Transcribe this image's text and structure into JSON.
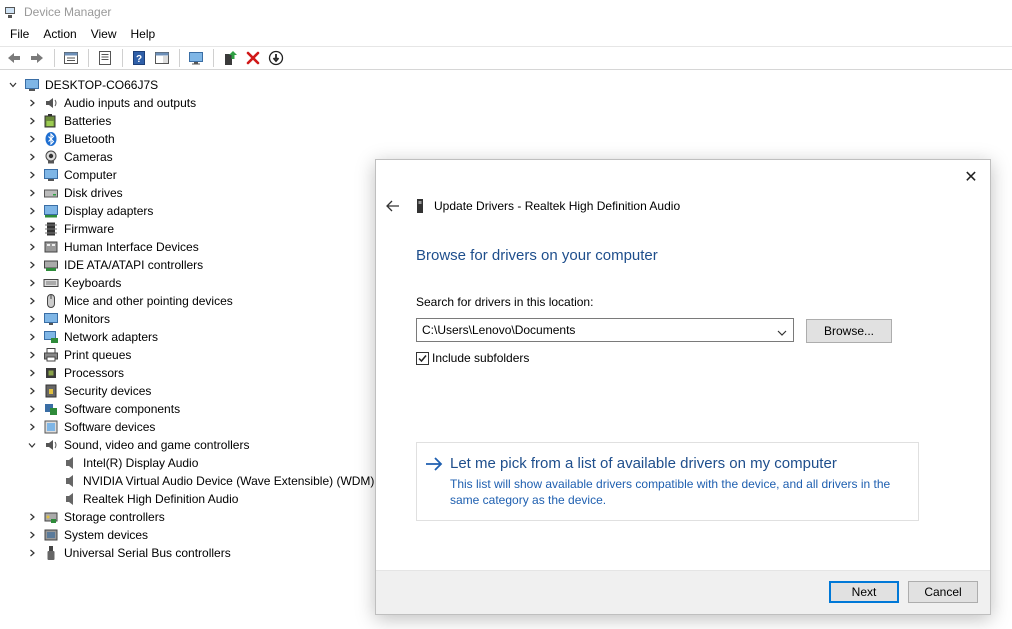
{
  "window": {
    "title": "Device Manager"
  },
  "menu": [
    "File",
    "Action",
    "View",
    "Help"
  ],
  "toolbar": {
    "buttons": [
      "back-icon",
      "forward-icon",
      "properties-icon",
      "show-hidden-icon",
      "help-icon",
      "action-pane-icon",
      "monitor-icon",
      "update-driver-icon",
      "uninstall-icon",
      "disable-icon"
    ]
  },
  "tree": {
    "root": "DESKTOP-CO66J7S",
    "categories": [
      {
        "label": "Audio inputs and outputs",
        "icon": "speaker-icon",
        "expanded": false
      },
      {
        "label": "Batteries",
        "icon": "battery-icon",
        "expanded": false
      },
      {
        "label": "Bluetooth",
        "icon": "bluetooth-icon",
        "expanded": false
      },
      {
        "label": "Cameras",
        "icon": "camera-icon",
        "expanded": false
      },
      {
        "label": "Computer",
        "icon": "computer-icon",
        "expanded": false
      },
      {
        "label": "Disk drives",
        "icon": "disk-icon",
        "expanded": false
      },
      {
        "label": "Display adapters",
        "icon": "display-adapter-icon",
        "expanded": false
      },
      {
        "label": "Firmware",
        "icon": "chip-icon",
        "expanded": false
      },
      {
        "label": "Human Interface Devices",
        "icon": "hid-icon",
        "expanded": false
      },
      {
        "label": "IDE ATA/ATAPI controllers",
        "icon": "ide-icon",
        "expanded": false
      },
      {
        "label": "Keyboards",
        "icon": "keyboard-icon",
        "expanded": false
      },
      {
        "label": "Mice and other pointing devices",
        "icon": "mouse-icon",
        "expanded": false
      },
      {
        "label": "Monitors",
        "icon": "monitor-icon",
        "expanded": false
      },
      {
        "label": "Network adapters",
        "icon": "network-icon",
        "expanded": false
      },
      {
        "label": "Print queues",
        "icon": "printer-icon",
        "expanded": false
      },
      {
        "label": "Processors",
        "icon": "processor-icon",
        "expanded": false
      },
      {
        "label": "Security devices",
        "icon": "security-icon",
        "expanded": false
      },
      {
        "label": "Software components",
        "icon": "software-component-icon",
        "expanded": false
      },
      {
        "label": "Software devices",
        "icon": "software-device-icon",
        "expanded": false
      },
      {
        "label": "Sound, video and game controllers",
        "icon": "speaker-icon",
        "expanded": true,
        "children": [
          "Intel(R) Display Audio",
          "NVIDIA Virtual Audio Device (Wave Extensible) (WDM)",
          "Realtek High Definition Audio"
        ]
      },
      {
        "label": "Storage controllers",
        "icon": "storage-icon",
        "expanded": false
      },
      {
        "label": "System devices",
        "icon": "system-icon",
        "expanded": false
      },
      {
        "label": "Universal Serial Bus controllers",
        "icon": "usb-icon",
        "expanded": false
      }
    ]
  },
  "dialog": {
    "header": "Update Drivers - Realtek High Definition Audio",
    "heading": "Browse for drivers on your computer",
    "search_label": "Search for drivers in this location:",
    "path_value": "C:\\Users\\Lenovo\\Documents",
    "browse_label": "Browse...",
    "include_subfolders_label": "Include subfolders",
    "include_subfolders_checked": true,
    "pick_title": "Let me pick from a list of available drivers on my computer",
    "pick_description": "This list will show available drivers compatible with the device, and all drivers in the same category as the device.",
    "next_label": "Next",
    "cancel_label": "Cancel",
    "close_symbol": "✕"
  },
  "colors": {
    "link_blue": "#1e4e8c",
    "desc_blue": "#1e5fb0",
    "accent": "#0078d7"
  }
}
